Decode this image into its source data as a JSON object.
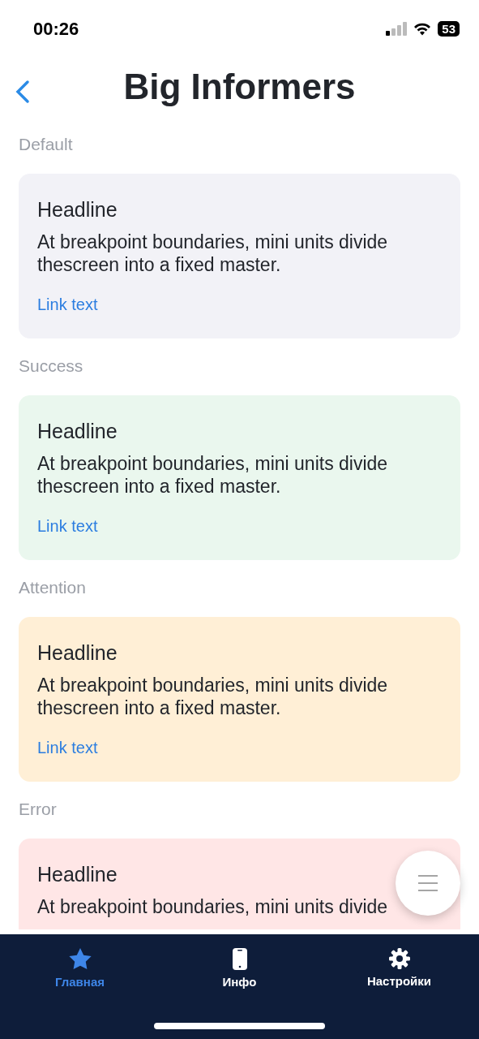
{
  "status_bar": {
    "time": "00:26",
    "battery": "53"
  },
  "header": {
    "title": "Big Informers"
  },
  "sections": [
    {
      "label": "Default",
      "card": {
        "kind": "default",
        "headline": "Headline",
        "body": "At breakpoint boundaries, mini units divide thescreen into a fixed master.",
        "link": "Link text"
      }
    },
    {
      "label": "Success",
      "card": {
        "kind": "success",
        "headline": "Headline",
        "body": "At breakpoint boundaries, mini units divide thescreen into a fixed master.",
        "link": "Link text"
      }
    },
    {
      "label": "Attention",
      "card": {
        "kind": "attention",
        "headline": "Headline",
        "body": "At breakpoint boundaries, mini units divide thescreen into a fixed master.",
        "link": "Link text"
      }
    },
    {
      "label": "Error",
      "card": {
        "kind": "error",
        "headline": "Headline",
        "body": "At breakpoint boundaries, mini units divide"
      }
    }
  ],
  "tab_bar": [
    {
      "label": "Главная",
      "selected": true
    },
    {
      "label": "Инфо",
      "selected": false
    },
    {
      "label": "Настройки",
      "selected": false
    }
  ]
}
